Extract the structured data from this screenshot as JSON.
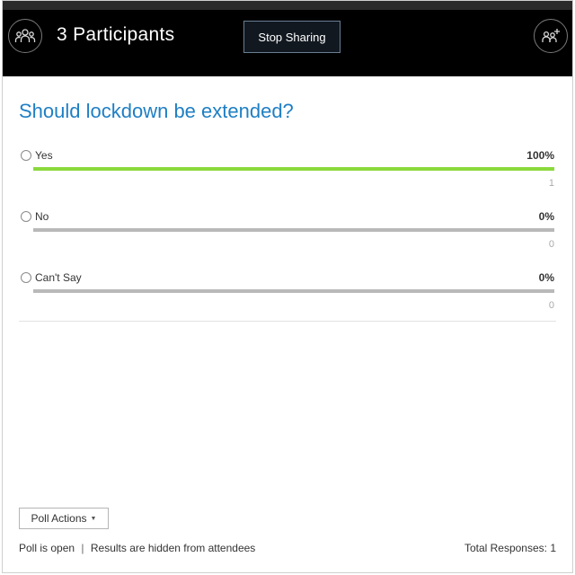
{
  "header": {
    "participants_title": "3 Participants",
    "stop_sharing_label": "Stop Sharing",
    "participants_icon": "people-group-icon",
    "add_participant_icon": "add-people-icon"
  },
  "poll": {
    "question": "Should lockdown be extended?",
    "options": [
      {
        "label": "Yes",
        "percent": "100%",
        "count": "1",
        "fraction": 1.0
      },
      {
        "label": "No",
        "percent": "0%",
        "count": "0",
        "fraction": 0.0
      },
      {
        "label": "Can't Say",
        "percent": "0%",
        "count": "0",
        "fraction": 0.0
      }
    ],
    "actions_label": "Poll Actions",
    "status_open": "Poll is open",
    "status_separator": "|",
    "status_hidden": "Results are hidden from attendees",
    "total_responses": "Total Responses: 1"
  },
  "colors": {
    "accent_blue": "#1f7fc4",
    "bar_fill": "#8bd93c",
    "bar_track": "#b9b9b9",
    "header_bg": "#000000"
  }
}
